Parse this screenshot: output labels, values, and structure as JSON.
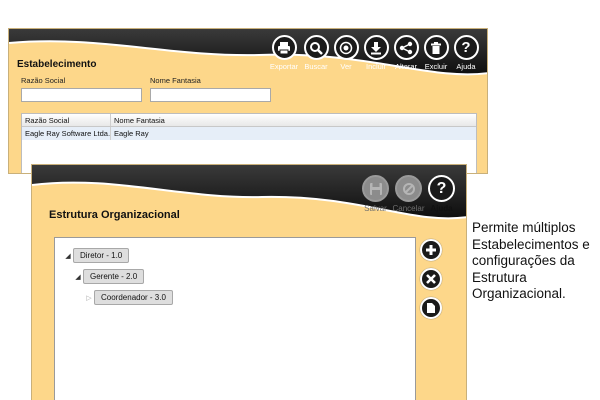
{
  "establishment_window": {
    "title": "Estabelecimento",
    "toolbar": [
      {
        "label": "Exportar",
        "icon": "printer-icon"
      },
      {
        "label": "Buscar",
        "icon": "search-icon"
      },
      {
        "label": "Ver",
        "icon": "eye-icon"
      },
      {
        "label": "Incluir",
        "icon": "download-icon"
      },
      {
        "label": "Alterar",
        "icon": "share-icon"
      },
      {
        "label": "Excluir",
        "icon": "trash-icon"
      },
      {
        "label": "Ajuda",
        "icon": "help-icon"
      }
    ],
    "filters": {
      "razao_social_label": "Razão Social",
      "razao_social_value": "",
      "nome_fantasia_label": "Nome Fantasia",
      "nome_fantasia_value": ""
    },
    "grid": {
      "columns": [
        "Razão Social",
        "Nome Fantasia"
      ],
      "rows": [
        [
          "Eagle Ray Software Ltda.",
          "Eagle Ray"
        ]
      ]
    }
  },
  "org_window": {
    "title": "Estrutura Organizacional",
    "toolbar": [
      {
        "label": "Salvar",
        "icon": "save-icon",
        "enabled": false
      },
      {
        "label": "Cancelar",
        "icon": "cancel-icon",
        "enabled": false
      },
      {
        "label": "Ajuda",
        "icon": "help-icon",
        "enabled": true
      }
    ],
    "tree": [
      {
        "label": "Diretor - 1.0",
        "level": 0,
        "expanded": true
      },
      {
        "label": "Gerente - 2.0",
        "level": 1,
        "expanded": true
      },
      {
        "label": "Coordenador - 3.0",
        "level": 2,
        "expanded": false
      }
    ],
    "side_actions": [
      {
        "icon": "plus-icon"
      },
      {
        "icon": "close-icon"
      },
      {
        "icon": "document-icon"
      }
    ]
  },
  "caption": "Permite múltiplos Estabelecimentos e configurações da Estrutura Organizacional.",
  "colors": {
    "window_bg": "#fdd78a",
    "header_dark": "#1c1c1c",
    "selected_row": "#e6eef8"
  }
}
